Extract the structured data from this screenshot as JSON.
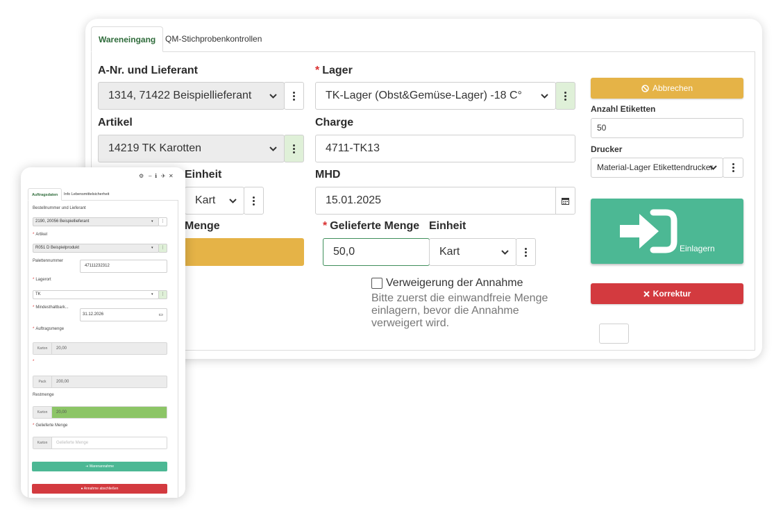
{
  "main": {
    "tabs": [
      {
        "label": "Wareneingang",
        "active": true
      },
      {
        "label": "QM-Stichprobenkontrollen",
        "active": false
      }
    ],
    "fields": {
      "supplier": {
        "label": "A-Nr. und Lieferant",
        "value": "1314, 71422 Beispiellieferant"
      },
      "storage": {
        "label": "Lager",
        "value": "TK-Lager (Obst&Gemüse-Lager) -18 C°"
      },
      "article": {
        "label": "Artikel",
        "value": "14219 TK Karotten"
      },
      "batch": {
        "label": "Charge",
        "value": "4711-TK13"
      },
      "unit_left": {
        "label": "Einheit",
        "value": "Kart"
      },
      "best_before": {
        "label": "MHD",
        "value": "15.01.2025"
      },
      "quantity_left": {
        "label": "Menge"
      },
      "delivered_qty": {
        "label": "Gelieferte Menge",
        "value": "50,0"
      },
      "unit_right": {
        "label": "Einheit",
        "value": "Kart"
      }
    },
    "refuse": {
      "label": "Verweigerung der Annahme",
      "checked": false
    },
    "hint": "Bitte zuerst die einwandfreie Menge einlagern, bevor die Annahme verweigert wird.",
    "sidebar": {
      "cancel_label": "Abbrechen",
      "label_count_label": "Anzahl Etiketten",
      "label_count_value": "50",
      "printer_label": "Drucker",
      "printer_value": "Material-Lager Etikettendrucker",
      "store_label": "Einlagern",
      "correction_label": "Korrektur"
    },
    "colors": {
      "cancel": "#e5b347",
      "store": "#4cb894",
      "correction": "#d33a3f",
      "accent": "#2e6b3a"
    }
  },
  "phone": {
    "tabs": [
      {
        "label": "Auftragsdaten",
        "active": true
      },
      {
        "label": "Info Lebensmittelsicherheit",
        "active": false
      }
    ],
    "order_label": "Bestellnummer und Lieferant",
    "order_value": "2190, 20056 Beispiellieferant",
    "article_label": "Artikel",
    "article_value": "R051 D Beispielprodukt",
    "pallet_label": "Palettennummer",
    "pallet_value": "47111232312",
    "location_label": "Lagerort",
    "location_value": "TK",
    "mhd_label": "Mindesthaltbark...",
    "mhd_value": "31.12.2026",
    "order_qty_label": "Auftragsmenge",
    "order_qty_unit": "Karton",
    "order_qty_value": "20,00",
    "pack_unit": "Pack",
    "pack_value": "200,00",
    "rest_label": "Restmenge",
    "rest_unit": "Karton",
    "rest_value": "20,00",
    "delivered_label": "Gelieferte Menge",
    "delivered_unit": "Karton",
    "delivered_placeholder": "Gelieferte Menge",
    "receive_label": "Warenannahme",
    "close_label": "Annahme abschließen"
  }
}
